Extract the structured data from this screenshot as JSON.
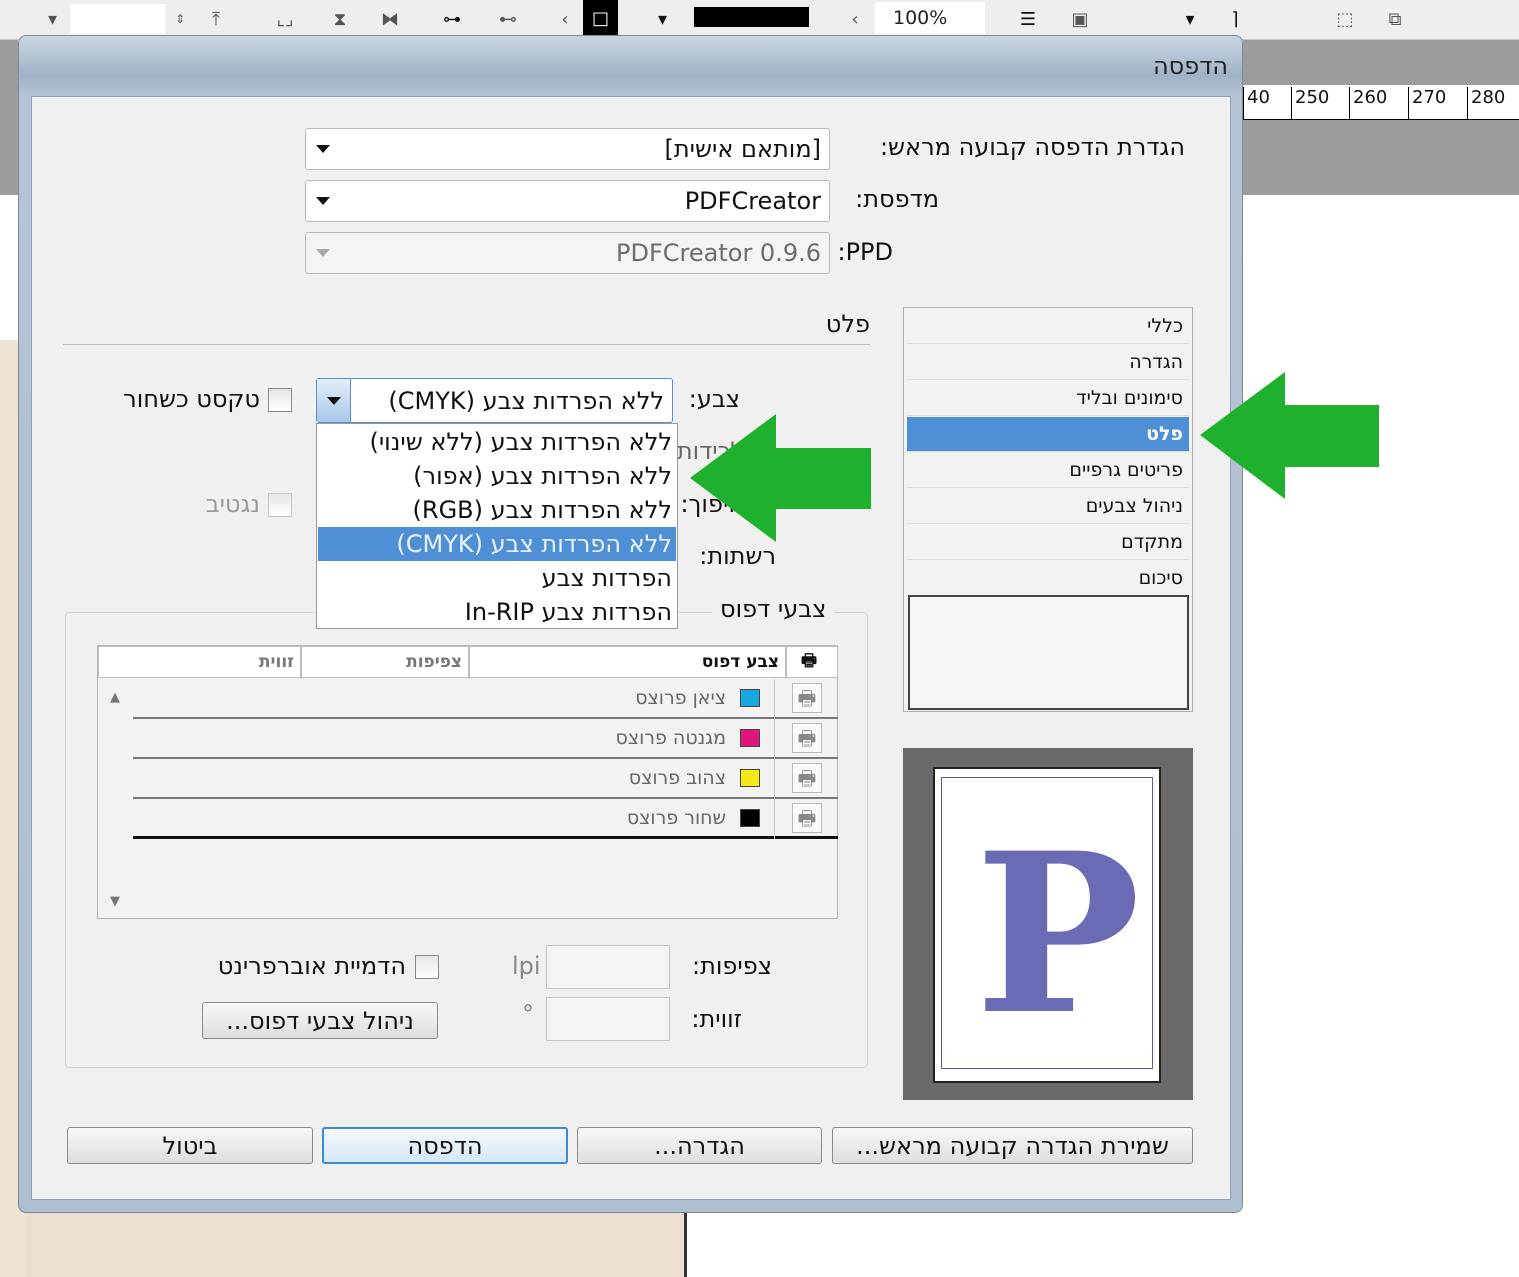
{
  "toolbar": {
    "zoom": "100%"
  },
  "ruler": {
    "ticks": [
      "40",
      "250",
      "260",
      "270",
      "280"
    ]
  },
  "dialog": {
    "title": "הדפסה",
    "preset_label": "הגדרת הדפסה קבועה מראש:",
    "preset_value": "[מותאם אישית]",
    "printer_label": "מדפסת:",
    "printer_value": "PDFCreator",
    "ppd_label": "PPD:",
    "ppd_value": "PDFCreator 0.9.6",
    "section_title": "פלט",
    "categories": [
      {
        "label": "כללי"
      },
      {
        "label": "הגדרה"
      },
      {
        "label": "סימונים ובליד"
      },
      {
        "label": "פלט"
      },
      {
        "label": "פריטים גרפיים"
      },
      {
        "label": "ניהול צבעים"
      },
      {
        "label": "מתקדם"
      },
      {
        "label": "סיכום"
      }
    ],
    "selected_category": "פלט",
    "color_label": "צבע:",
    "color_value": "ללא הפרדות צבע (CMYK)",
    "trapping_label": "לכידות:",
    "flip_label": "היפוך:",
    "screening_label": "רשתות:",
    "text_black_label": "טקסט כשחור",
    "negative_label": "נגטיב",
    "color_options": [
      "ללא הפרדות צבע (ללא שינוי)",
      "ללא הפרדות צבע (אפור)",
      "ללא הפרדות צבע (RGB)",
      "ללא הפרדות צבע (CMYK)",
      "הפרדות צבע",
      "הפרדות צבע In-RIP"
    ],
    "inks_group": "צבעי דפוס",
    "inks_columns": [
      "צבע דפוס",
      "צפיפות",
      "זווית"
    ],
    "inks": [
      {
        "name": "ציאן פרוצס",
        "color": "#1aa6e0"
      },
      {
        "name": "מגנטה פרוצס",
        "color": "#e0157a"
      },
      {
        "name": "צהוב פרוצס",
        "color": "#f2e81a"
      },
      {
        "name": "שחור פרוצס",
        "color": "#000000"
      }
    ],
    "frequency_label": "צפיפות:",
    "frequency_unit": "lpi",
    "angle_label": "זווית:",
    "angle_unit": "°",
    "overprint_label": "הדמיית אוברפרינט",
    "ink_manager_button": "ניהול צבעי דפוס...",
    "preview_letter": "P",
    "buttons": {
      "save_preset": "שמירת הגדרה קבועה מראש...",
      "setup": "הגדרה...",
      "print": "הדפסה",
      "cancel": "ביטול"
    }
  },
  "colors": {
    "accent": "#4f8fd6",
    "arrow": "#1fb02e"
  }
}
